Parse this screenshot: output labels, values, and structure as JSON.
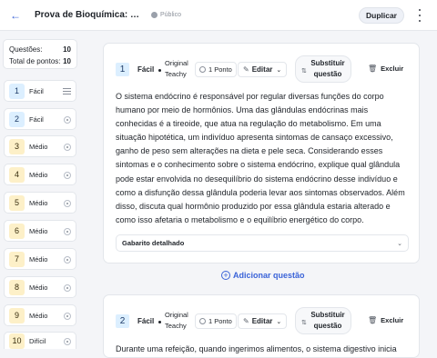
{
  "header": {
    "title": "Prova de Bioquímica: Carboidratos",
    "visibility": "Público",
    "duplicate_label": "Duplicar"
  },
  "sidebar": {
    "stats": {
      "questions_label": "Questões:",
      "questions_value": "10",
      "points_label": "Total de pontos:",
      "points_value": "10"
    },
    "items": [
      {
        "number": "1",
        "difficulty": "Fácil"
      },
      {
        "number": "2",
        "difficulty": "Fácil"
      },
      {
        "number": "3",
        "difficulty": "Médio"
      },
      {
        "number": "4",
        "difficulty": "Médio"
      },
      {
        "number": "5",
        "difficulty": "Médio"
      },
      {
        "number": "6",
        "difficulty": "Médio"
      },
      {
        "number": "7",
        "difficulty": "Médio"
      },
      {
        "number": "8",
        "difficulty": "Médio"
      },
      {
        "number": "9",
        "difficulty": "Médio"
      },
      {
        "number": "10",
        "difficulty": "Difícil"
      }
    ]
  },
  "questions": [
    {
      "number": "1",
      "difficulty": "Fácil",
      "origin": "Original Teachy",
      "points": "1 Ponto",
      "edit_label": "Editar",
      "substitute_label": "Substituir questão",
      "delete_label": "Excluir",
      "text": "O sistema endócrino é responsável por regular diversas funções do corpo humano por meio de hormônios. Uma das glândulas endócrinas mais conhecidas é a tireoide, que atua na regulação do metabolismo. Em uma situação hipotética, um indivíduo apresenta sintomas de cansaço excessivo, ganho de peso sem alterações na dieta e pele seca. Considerando esses sintomas e o conhecimento sobre o sistema endócrino, explique qual glândula pode estar envolvida no desequilíbrio do sistema endócrino desse indivíduo e como a disfunção dessa glândula poderia levar aos sintomas observados. Além disso, discuta qual hormônio produzido por essa glândula estaria alterado e como isso afetaria o metabolismo e o equilíbrio energético do corpo.",
      "answer_label": "Gabarito detalhado"
    },
    {
      "number": "2",
      "difficulty": "Fácil",
      "origin": "Original Teachy",
      "points": "1 Ponto",
      "edit_label": "Editar",
      "substitute_label": "Substituir questão",
      "delete_label": "Excluir",
      "text": "Durante uma refeição, quando ingerimos alimentos, o sistema digestivo inicia"
    }
  ],
  "add_question_label": "Adicionar questão",
  "colors": {
    "accent": "#3a63d8",
    "easy": "#dcefff",
    "medium": "#fdf0c8"
  }
}
